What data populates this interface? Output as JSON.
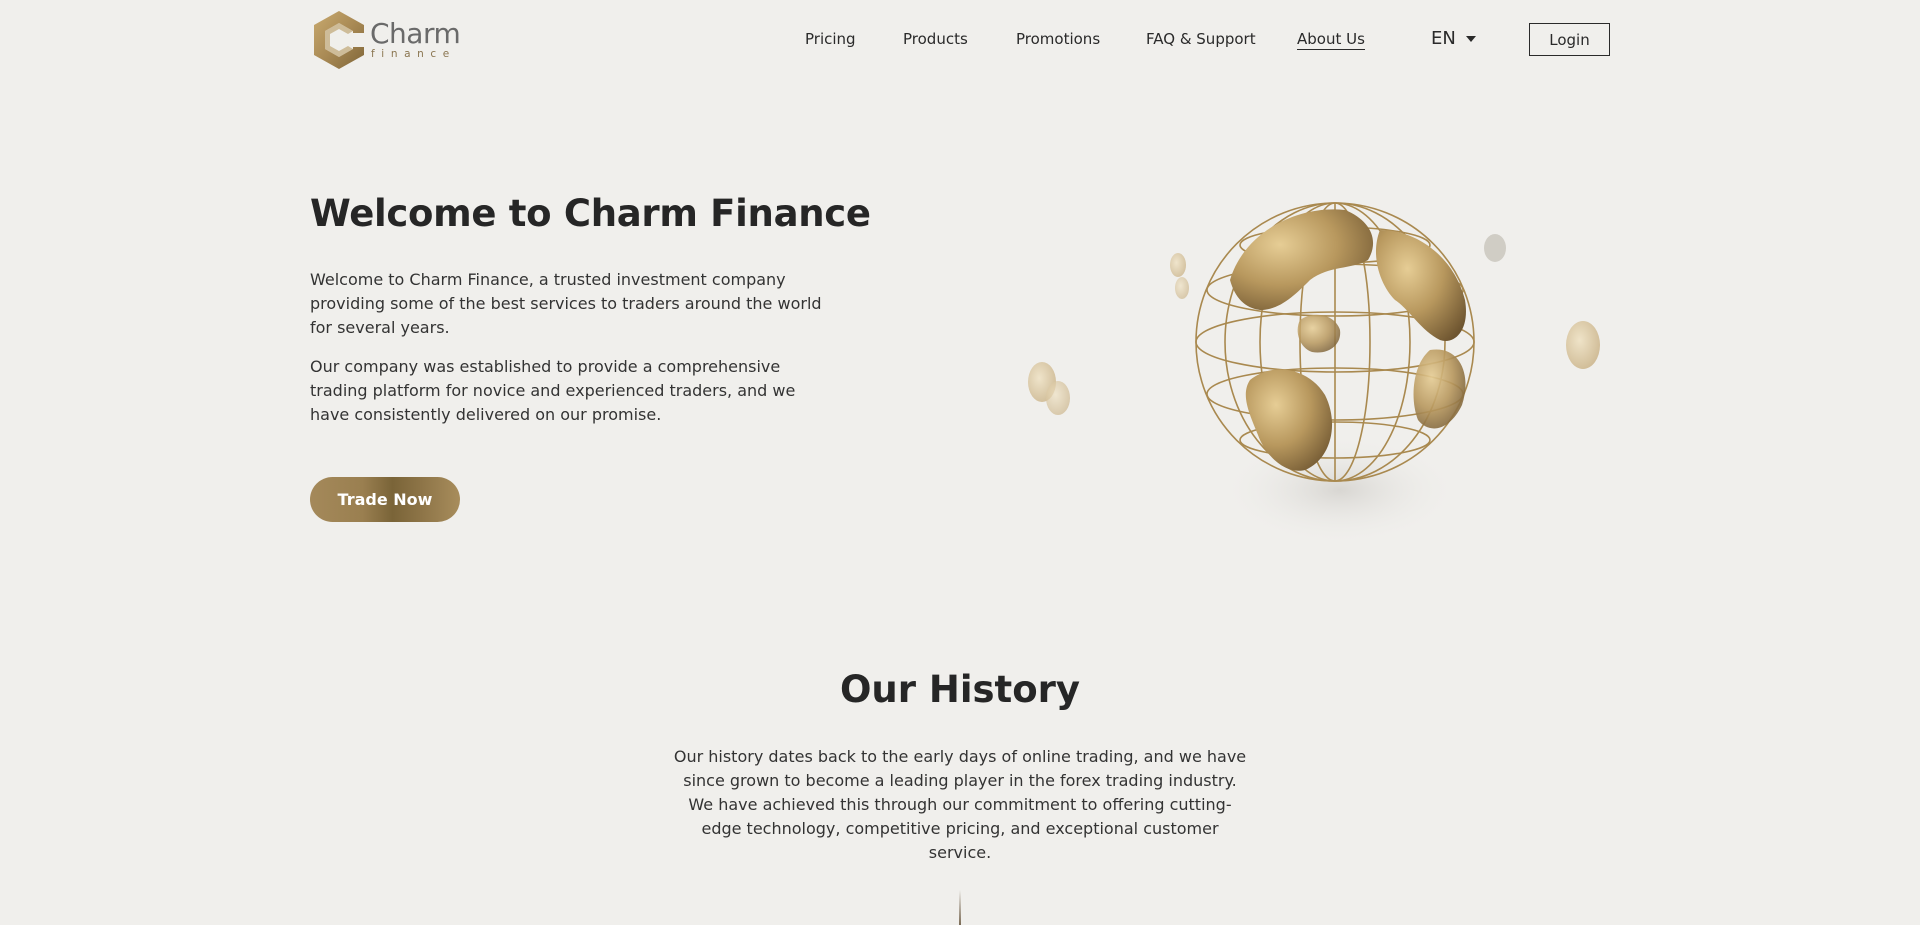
{
  "brand": {
    "name": "Charm",
    "subtitle": "finance",
    "accent_color": "#a4895a"
  },
  "nav": {
    "items": [
      {
        "label": "Pricing"
      },
      {
        "label": "Products"
      },
      {
        "label": "Promotions"
      },
      {
        "label": "FAQ & Support"
      },
      {
        "label": "About Us",
        "active": true
      }
    ],
    "language": "EN",
    "login_label": "Login"
  },
  "hero": {
    "title": "Welcome to Charm Finance",
    "paragraph1": "Welcome to Charm Finance, a trusted investment company providing some of the best services to traders around the world for several years.",
    "paragraph2": "Our company was established to provide a comprehensive trading platform for novice and experienced traders, and we have consistently delivered on our promise.",
    "cta_label": "Trade Now",
    "illustration": "golden-globe-with-coins"
  },
  "history": {
    "title": "Our History",
    "paragraph": "Our history dates back to the early days of online trading, and we have since grown to become a leading player in the forex trading industry. We have achieved this through our commitment to offering cutting-edge technology, competitive pricing, and exceptional customer service."
  }
}
